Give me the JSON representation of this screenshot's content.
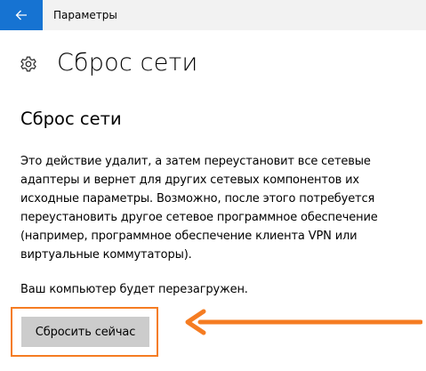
{
  "header": {
    "back_icon": "arrow-left-icon",
    "app_title": "Параметры",
    "accent_color": "#1673d2"
  },
  "page": {
    "icon": "gear-icon",
    "title": "Сброс сети"
  },
  "section": {
    "title": "Сброс сети",
    "description_lines": [
      "Это действие удалит, а затем переустановит все сетевые",
      "адаптеры и вернет для других сетевых компонентов их",
      "исходные параметры. Возможно, после этого потребуется",
      "переустановить другое сетевое программное обеспечение",
      "(например, программное обеспечение клиента VPN или",
      "виртуальные коммутаторы)."
    ],
    "restart_note": "Ваш компьютер будет перезагружен.",
    "reset_button_label": "Сбросить сейчас"
  },
  "annotation": {
    "color": "#f57c22",
    "arrow_icon": "arrow-left-annotation-icon"
  }
}
